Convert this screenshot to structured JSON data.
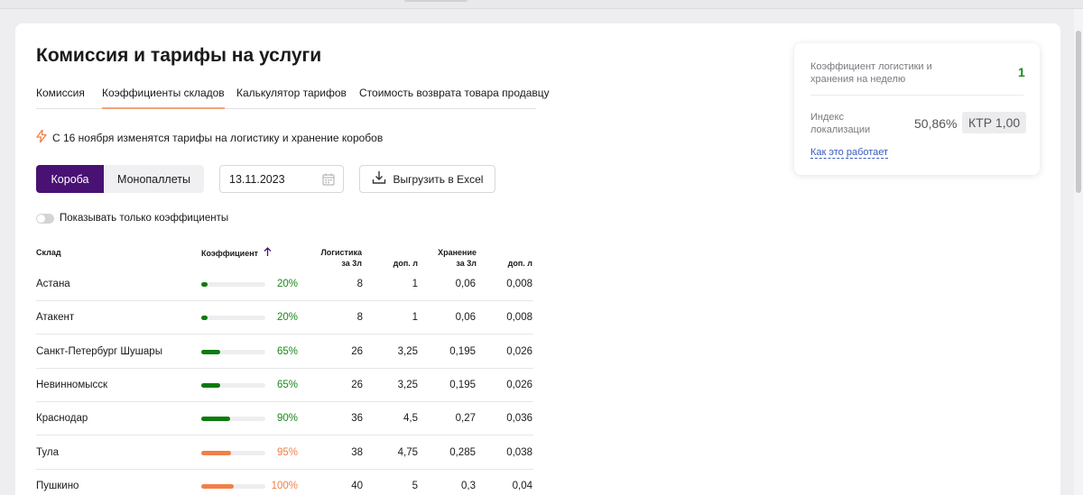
{
  "page": {
    "title": "Комиссия и тарифы на услуги"
  },
  "tabs": [
    {
      "label": "Комиссия",
      "active": false
    },
    {
      "label": "Коэффициенты складов",
      "active": true
    },
    {
      "label": "Калькулятор тарифов",
      "active": false
    },
    {
      "label": "Стоимость возврата товара продавцу",
      "active": false
    }
  ],
  "notice": {
    "icon": "lightning-icon",
    "text": "С 16 ноября изменятся тарифы на логистику и хранение коробов"
  },
  "filters": {
    "segment": [
      {
        "label": "Короба",
        "selected": true
      },
      {
        "label": "Монопаллеты",
        "selected": false
      }
    ],
    "date_value": "13.11.2023",
    "export_label": "Выгрузить в Excel",
    "toggle_label": "Показывать только коэффициенты",
    "toggle_on": false
  },
  "table": {
    "headers": {
      "warehouse": "Склад",
      "coef": "Коэффициент",
      "logistics": "Логистика",
      "logistics_sub": "за 3л",
      "log_extra": "доп. л",
      "storage": "Хранение",
      "storage_sub": "за 3л",
      "stor_extra": "доп. л"
    },
    "rows": [
      {
        "warehouse": "Астана",
        "coef": "20%",
        "coef_fraction": 0.05,
        "status": "green",
        "logistics": "8",
        "log_extra": "1",
        "storage": "0,06",
        "stor_extra": "0,008"
      },
      {
        "warehouse": "Атакент",
        "coef": "20%",
        "coef_fraction": 0.05,
        "status": "green",
        "logistics": "8",
        "log_extra": "1",
        "storage": "0,06",
        "stor_extra": "0,008"
      },
      {
        "warehouse": "Санкт-Петербург Шушары",
        "coef": "65%",
        "coef_fraction": 0.3,
        "status": "green",
        "logistics": "26",
        "log_extra": "3,25",
        "storage": "0,195",
        "stor_extra": "0,026"
      },
      {
        "warehouse": "Невинномысск",
        "coef": "65%",
        "coef_fraction": 0.3,
        "status": "green",
        "logistics": "26",
        "log_extra": "3,25",
        "storage": "0,195",
        "stor_extra": "0,026"
      },
      {
        "warehouse": "Краснодар",
        "coef": "90%",
        "coef_fraction": 0.45,
        "status": "green",
        "logistics": "36",
        "log_extra": "4,5",
        "storage": "0,27",
        "stor_extra": "0,036"
      },
      {
        "warehouse": "Тула",
        "coef": "95%",
        "coef_fraction": 0.47,
        "status": "orange",
        "logistics": "38",
        "log_extra": "4,75",
        "storage": "0,285",
        "stor_extra": "0,038"
      },
      {
        "warehouse": "Пушкино",
        "coef": "100%",
        "coef_fraction": 0.5,
        "status": "orange",
        "logistics": "40",
        "log_extra": "5",
        "storage": "0,3",
        "stor_extra": "0,04"
      }
    ]
  },
  "side_card": {
    "label1": "Коэффициент логистики и хранения на неделю",
    "value1": "1",
    "label2": "Индекс локализации",
    "value2": "50,86%",
    "ktr": "КТР 1,00",
    "link": "Как это работает"
  },
  "colors": {
    "accent": "#481173",
    "green": "#1a8a1a",
    "orange": "#f0804a",
    "green_bar": "#0f7a0f"
  }
}
